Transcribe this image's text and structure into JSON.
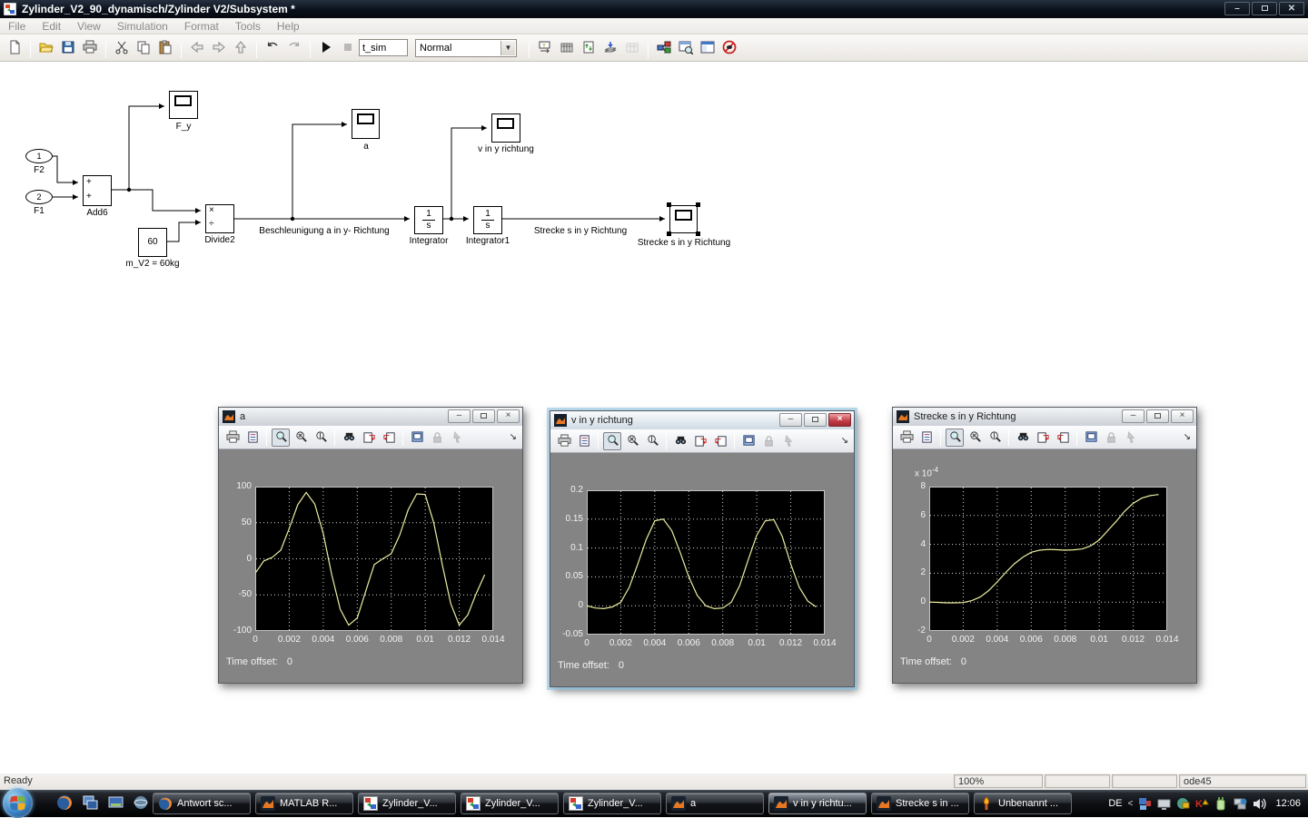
{
  "window": {
    "title": "Zylinder_V2_90_dynamisch/Zylinder V2/Subsystem *"
  },
  "menu": {
    "items": [
      "File",
      "Edit",
      "View",
      "Simulation",
      "Format",
      "Tools",
      "Help"
    ]
  },
  "toolbar": {
    "sim_time_value": "t_sim",
    "mode_value": "Normal",
    "left_icons": [
      "new",
      "open",
      "save",
      "print",
      "cut",
      "copy",
      "paste",
      "back",
      "forward",
      "up",
      "undo",
      "redo",
      "play",
      "stop"
    ],
    "right_icons": [
      "target",
      "build",
      "update",
      "library-link",
      "build-all",
      "library-browser",
      "model-browser",
      "workspace",
      "debug-stop"
    ]
  },
  "diagram": {
    "inport1": {
      "num": "1",
      "label": "F2"
    },
    "inport2": {
      "num": "2",
      "label": "F1"
    },
    "add_block": {
      "sign1": "+",
      "sign2": "+",
      "label": "Add6"
    },
    "scope_fy": {
      "label": "F_y"
    },
    "constant": {
      "value": "60",
      "label": "m_V2 = 60kg"
    },
    "divide": {
      "sign1": "×",
      "sign2": "÷",
      "label": "Divide2"
    },
    "scope_a": {
      "label": "a"
    },
    "signal_accel": "Beschleunigung a in y- Richtung",
    "integrator": {
      "num": "1",
      "den": "s",
      "label": "Integrator"
    },
    "scope_v": {
      "label": "v in y richtung"
    },
    "integrator1": {
      "num": "1",
      "den": "s",
      "label": "Integrator1"
    },
    "signal_strecke": "Strecke s in y Richtung",
    "scope_s": {
      "label": "Strecke s in y Richtung"
    }
  },
  "scope_windows": [
    {
      "title": "a",
      "time_offset_label": "Time offset:",
      "time_offset_value": "0"
    },
    {
      "title": "v in y richtung",
      "time_offset_label": "Time offset:",
      "time_offset_value": "0"
    },
    {
      "title": "Strecke s in y Richtung",
      "time_offset_label": "Time offset:",
      "time_offset_value": "0"
    }
  ],
  "scope_toolbar_icons": [
    "print",
    "parameters",
    "zoom",
    "zoom-x",
    "zoom-y",
    "autoscale",
    "save-axes",
    "restore-axes",
    "floating-scope",
    "lock-axes",
    "signal-selection",
    "dock"
  ],
  "chart_data": [
    {
      "type": "line",
      "title": "a",
      "bg": "#000000",
      "line_color": "#ededa0",
      "grid": true,
      "xlim": [
        0,
        0.014
      ],
      "ylim": [
        -100,
        100
      ],
      "xticks": [
        0,
        0.002,
        0.004,
        0.006,
        0.008,
        0.01,
        0.012,
        0.014
      ],
      "xtick_labels": [
        "0",
        "0.002",
        "0.004",
        "0.006",
        "0.008",
        "0.01",
        "0.012",
        "0.014"
      ],
      "yticks": [
        -100,
        -50,
        0,
        50,
        100
      ],
      "ytick_labels": [
        "-100",
        "-50",
        "0",
        "50",
        "100"
      ],
      "x": [
        0,
        0.0005,
        0.001,
        0.0015,
        0.002,
        0.0025,
        0.003,
        0.0035,
        0.004,
        0.0045,
        0.005,
        0.0055,
        0.006,
        0.0065,
        0.007,
        0.0075,
        0.008,
        0.0085,
        0.009,
        0.0095,
        0.01,
        0.0105,
        0.011,
        0.0115,
        0.012,
        0.0125,
        0.013,
        0.0135
      ],
      "y": [
        -20,
        -3,
        2,
        12,
        42,
        75,
        92,
        76,
        35,
        -22,
        -70,
        -92,
        -82,
        -45,
        -8,
        0,
        7,
        33,
        68,
        90,
        89,
        50,
        -8,
        -62,
        -92,
        -78,
        -48,
        -22
      ]
    },
    {
      "type": "line",
      "title": "v in y richtung",
      "bg": "#000000",
      "line_color": "#ededa0",
      "grid": true,
      "xlim": [
        0,
        0.014
      ],
      "ylim": [
        -0.05,
        0.2
      ],
      "xticks": [
        0,
        0.002,
        0.004,
        0.006,
        0.008,
        0.01,
        0.012,
        0.014
      ],
      "xtick_labels": [
        "0",
        "0.002",
        "0.004",
        "0.006",
        "0.008",
        "0.01",
        "0.012",
        "0.014"
      ],
      "yticks": [
        -0.05,
        0,
        0.05,
        0.1,
        0.15,
        0.2
      ],
      "ytick_labels": [
        "-0.05",
        "0",
        "0.05",
        "0.1",
        "0.15",
        "0.2"
      ],
      "x": [
        0,
        0.0005,
        0.001,
        0.0015,
        0.002,
        0.0025,
        0.003,
        0.0035,
        0.004,
        0.0045,
        0.005,
        0.0055,
        0.006,
        0.0065,
        0.007,
        0.0075,
        0.008,
        0.0085,
        0.009,
        0.0095,
        0.01,
        0.0105,
        0.011,
        0.0115,
        0.012,
        0.0125,
        0.013,
        0.0135
      ],
      "y": [
        0,
        -0.004,
        -0.005,
        -0.002,
        0.006,
        0.032,
        0.072,
        0.115,
        0.147,
        0.15,
        0.13,
        0.092,
        0.05,
        0.018,
        0,
        -0.005,
        -0.004,
        0.006,
        0.035,
        0.08,
        0.122,
        0.147,
        0.149,
        0.12,
        0.072,
        0.032,
        0.008,
        -0.002
      ]
    },
    {
      "type": "line",
      "title": "Strecke s in y Richtung",
      "bg": "#000000",
      "line_color": "#ededa0",
      "grid": true,
      "exp_base": "x 10",
      "exp_sup": "-4",
      "xlim": [
        0,
        0.014
      ],
      "ylim": [
        -2,
        8
      ],
      "xticks": [
        0,
        0.002,
        0.004,
        0.006,
        0.008,
        0.01,
        0.012,
        0.014
      ],
      "xtick_labels": [
        "0",
        "0.002",
        "0.004",
        "0.006",
        "0.008",
        "0.01",
        "0.012",
        "0.014"
      ],
      "yticks": [
        -2,
        0,
        2,
        4,
        6,
        8
      ],
      "ytick_labels": [
        "-2",
        "0",
        "2",
        "4",
        "6",
        "8"
      ],
      "x": [
        0,
        0.0005,
        0.001,
        0.0015,
        0.002,
        0.0025,
        0.003,
        0.0035,
        0.004,
        0.0045,
        0.005,
        0.0055,
        0.006,
        0.0065,
        0.007,
        0.0075,
        0.008,
        0.0085,
        0.009,
        0.0095,
        0.01,
        0.0105,
        0.011,
        0.0115,
        0.012,
        0.0125,
        0.013,
        0.0135
      ],
      "y": [
        0,
        -0.02,
        -0.05,
        -0.05,
        -0.03,
        0.1,
        0.35,
        0.8,
        1.4,
        2.05,
        2.65,
        3.1,
        3.45,
        3.6,
        3.65,
        3.63,
        3.6,
        3.62,
        3.68,
        3.9,
        4.3,
        4.95,
        5.6,
        6.3,
        6.85,
        7.2,
        7.38,
        7.45
      ]
    }
  ],
  "statusbar": {
    "ready": "Ready",
    "zoom": "100%",
    "solver": "ode45"
  },
  "taskbar": {
    "buttons": [
      {
        "icon": "firefox",
        "label": "Antwort sc..."
      },
      {
        "icon": "matlab",
        "label": "MATLAB R..."
      },
      {
        "icon": "simulink",
        "label": "Zylinder_V..."
      },
      {
        "icon": "simulink",
        "label": "Zylinder_V..."
      },
      {
        "icon": "simulink",
        "label": "Zylinder_V..."
      },
      {
        "icon": "matlab",
        "label": "a"
      },
      {
        "icon": "matlab",
        "label": "v in y richtu...",
        "active": true
      },
      {
        "icon": "matlab",
        "label": "Strecke s in ..."
      },
      {
        "icon": "paint",
        "label": "Unbenannt ..."
      }
    ],
    "tray": {
      "lang": "DE",
      "chevron": "<",
      "time": "12:06"
    }
  }
}
